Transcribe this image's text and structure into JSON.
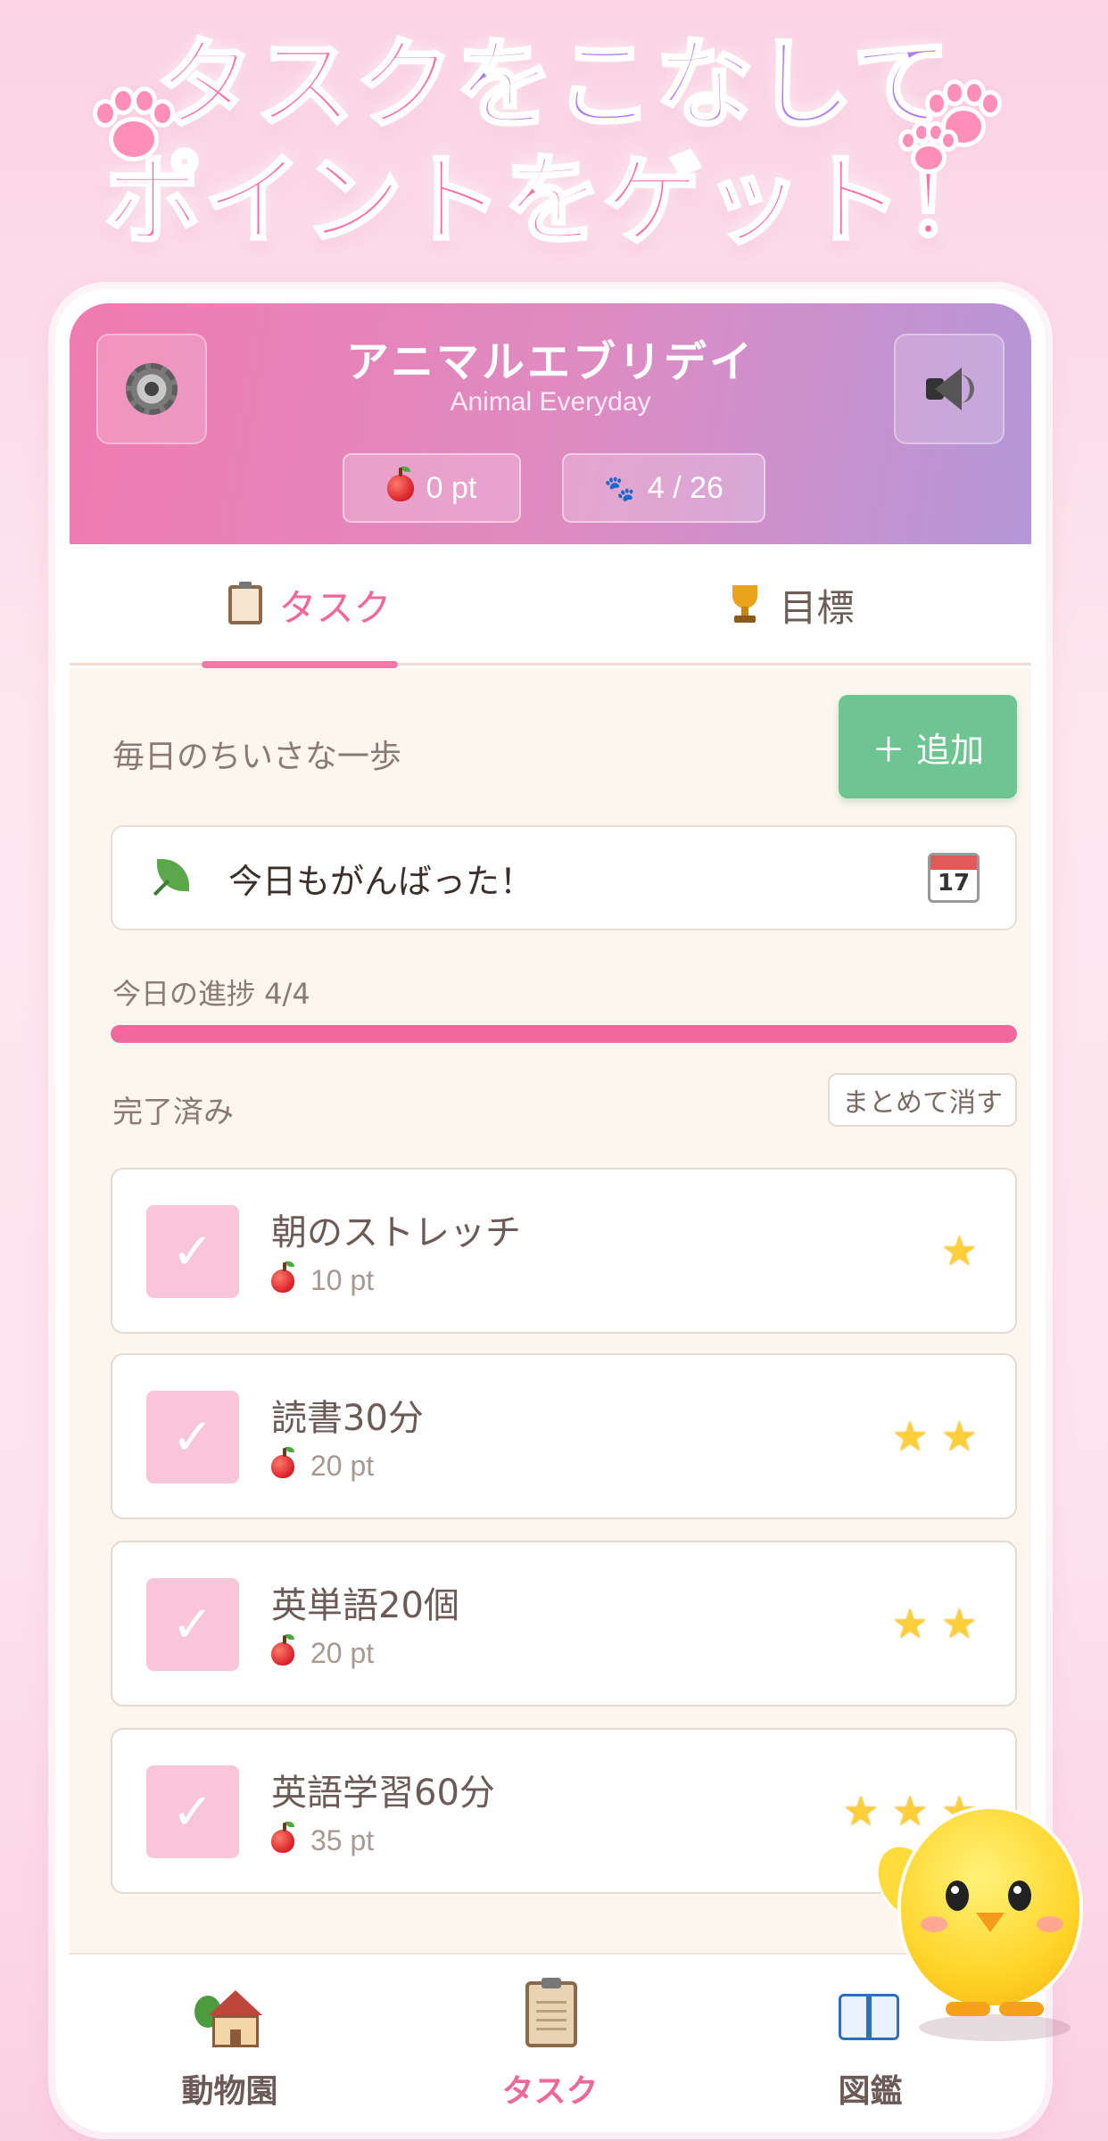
{
  "hero": {
    "line1_pink": "タスク",
    "line1_purple": "をこなして",
    "line2": "ポイントをゲット！"
  },
  "header": {
    "title": "アニマルエブリデイ",
    "subtitle": "Animal Everyday",
    "settings_icon": "gear-icon",
    "sound_icon": "speaker-icon",
    "points": "0 pt",
    "collection_count": "4 / 26"
  },
  "tabs": [
    {
      "label": "タスク",
      "icon": "clipboard-icon",
      "active": true
    },
    {
      "label": "目標",
      "icon": "trophy-icon",
      "active": false
    }
  ],
  "tasks_section": {
    "heading": "毎日のちいさな一歩",
    "add_label": "＋ 追加",
    "message": "今日もがんばった！",
    "calendar_day": "17",
    "progress_label": "今日の進捗 4/4",
    "progress_fraction": 1.0,
    "done_label": "完了済み",
    "clear_label": "まとめて消す",
    "items": [
      {
        "name": "朝のストレッチ",
        "points": "10 pt",
        "stars": 1,
        "checked": true
      },
      {
        "name": "読書30分",
        "points": "20 pt",
        "stars": 2,
        "checked": true
      },
      {
        "name": "英単語20個",
        "points": "20 pt",
        "stars": 2,
        "checked": true
      },
      {
        "name": "英語学習60分",
        "points": "35 pt",
        "stars": 3,
        "checked": true
      }
    ]
  },
  "nav": [
    {
      "label": "動物園",
      "icon": "zoo-house-icon",
      "active": false
    },
    {
      "label": "タスク",
      "icon": "clipboard-icon",
      "active": true
    },
    {
      "label": "図鑑",
      "icon": "book-icon",
      "active": false
    }
  ],
  "colors": {
    "accent_pink": "#f0679b",
    "add_green": "#6fc592",
    "header_start": "#f07bb0",
    "header_end": "#b496d8"
  }
}
